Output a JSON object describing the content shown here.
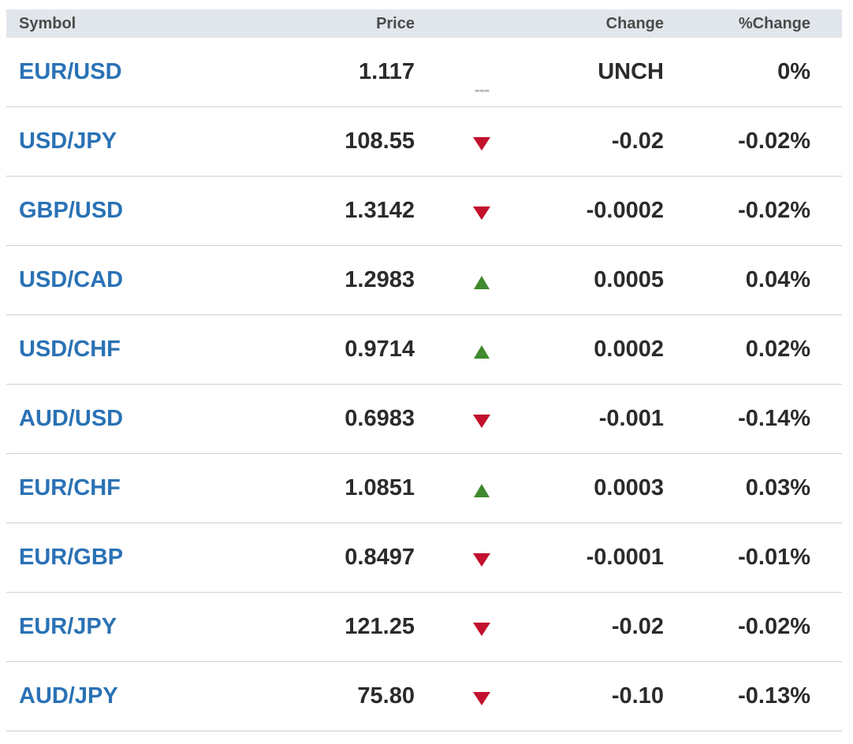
{
  "header": {
    "symbol": "Symbol",
    "price": "Price",
    "change": "Change",
    "pct_change": "%Change"
  },
  "colors": {
    "symbol_link": "#2a72b5",
    "down": "#c3102c",
    "up": "#3f8a2e",
    "header_bg": "#e1e6ec"
  },
  "rows": [
    {
      "symbol": "EUR/USD",
      "price": "1.117",
      "direction": "unchanged",
      "change": "UNCH",
      "pct": "0%"
    },
    {
      "symbol": "USD/JPY",
      "price": "108.55",
      "direction": "down",
      "change": "-0.02",
      "pct": "-0.02%"
    },
    {
      "symbol": "GBP/USD",
      "price": "1.3142",
      "direction": "down",
      "change": "-0.0002",
      "pct": "-0.02%"
    },
    {
      "symbol": "USD/CAD",
      "price": "1.2983",
      "direction": "up",
      "change": "0.0005",
      "pct": "0.04%"
    },
    {
      "symbol": "USD/CHF",
      "price": "0.9714",
      "direction": "up",
      "change": "0.0002",
      "pct": "0.02%"
    },
    {
      "symbol": "AUD/USD",
      "price": "0.6983",
      "direction": "down",
      "change": "-0.001",
      "pct": "-0.14%"
    },
    {
      "symbol": "EUR/CHF",
      "price": "1.0851",
      "direction": "up",
      "change": "0.0003",
      "pct": "0.03%"
    },
    {
      "symbol": "EUR/GBP",
      "price": "0.8497",
      "direction": "down",
      "change": "-0.0001",
      "pct": "-0.01%"
    },
    {
      "symbol": "EUR/JPY",
      "price": "121.25",
      "direction": "down",
      "change": "-0.02",
      "pct": "-0.02%"
    },
    {
      "symbol": "AUD/JPY",
      "price": "75.80",
      "direction": "down",
      "change": "-0.10",
      "pct": "-0.13%"
    }
  ],
  "unchanged_marker": "---"
}
